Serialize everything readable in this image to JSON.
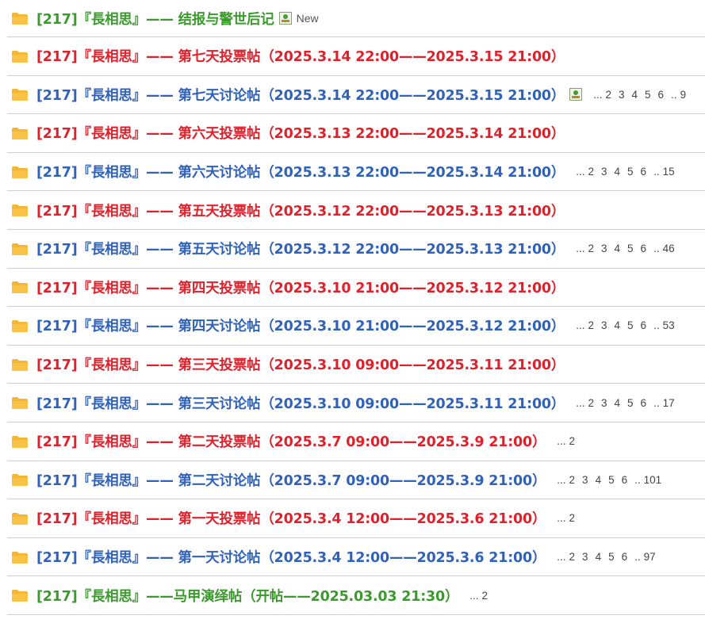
{
  "colors": {
    "green": "#3a9a2b",
    "red": "#e0202a",
    "blue": "#2f62b8",
    "folder": "#f5b732",
    "divider": "#cfcfcf"
  },
  "threads": [
    {
      "prefix": "[217]",
      "name": "『長相思』",
      "dash": "——",
      "topic": " 结报与警世后记",
      "date": "",
      "close": "",
      "color": "green",
      "has_image": true,
      "new_label": "New",
      "pager": []
    },
    {
      "prefix": "[217]",
      "name": "『長相思』",
      "dash": "——",
      "topic": " 第七天投票帖（",
      "date": "2025.3.14 22:00——2025.3.15 21:00",
      "close": "）",
      "color": "red",
      "has_image": false,
      "new_label": "",
      "pager": []
    },
    {
      "prefix": "[217]",
      "name": "『長相思』",
      "dash": "——",
      "topic": " 第七天讨论帖（",
      "date": "2025.3.14 22:00——2025.3.15 21:00",
      "close": "）",
      "color": "blue",
      "has_image": true,
      "new_label": "",
      "pager": [
        "2",
        "3",
        "4",
        "5",
        "6",
        "9"
      ]
    },
    {
      "prefix": "[217]",
      "name": "『長相思』",
      "dash": "——",
      "topic": " 第六天投票帖（",
      "date": "2025.3.13 22:00——2025.3.14 21:00",
      "close": "）",
      "color": "red",
      "has_image": false,
      "new_label": "",
      "pager": []
    },
    {
      "prefix": "[217]",
      "name": "『長相思』",
      "dash": "——",
      "topic": " 第六天讨论帖（",
      "date": "2025.3.13 22:00——2025.3.14 21:00",
      "close": "）",
      "color": "blue",
      "has_image": false,
      "new_label": "",
      "pager": [
        "2",
        "3",
        "4",
        "5",
        "6",
        "15"
      ]
    },
    {
      "prefix": "[217]",
      "name": "『長相思』",
      "dash": "——",
      "topic": " 第五天投票帖（",
      "date": "2025.3.12 22:00——2025.3.13 21:00",
      "close": "）",
      "color": "red",
      "has_image": false,
      "new_label": "",
      "pager": []
    },
    {
      "prefix": "[217]",
      "name": "『長相思』",
      "dash": "——",
      "topic": " 第五天讨论帖（",
      "date": "2025.3.12 22:00——2025.3.13 21:00",
      "close": "）",
      "color": "blue",
      "has_image": false,
      "new_label": "",
      "pager": [
        "2",
        "3",
        "4",
        "5",
        "6",
        "46"
      ]
    },
    {
      "prefix": "[217]",
      "name": "『長相思』",
      "dash": "——",
      "topic": " 第四天投票帖（",
      "date": "2025.3.10 21:00——2025.3.12 21:00",
      "close": "）",
      "color": "red",
      "has_image": false,
      "new_label": "",
      "pager": []
    },
    {
      "prefix": "[217]",
      "name": "『長相思』",
      "dash": "——",
      "topic": " 第四天讨论帖（",
      "date": "2025.3.10 21:00——2025.3.12 21:00",
      "close": "）",
      "color": "blue",
      "has_image": false,
      "new_label": "",
      "pager": [
        "2",
        "3",
        "4",
        "5",
        "6",
        "53"
      ]
    },
    {
      "prefix": "[217]",
      "name": "『長相思』",
      "dash": "——",
      "topic": " 第三天投票帖（",
      "date": "2025.3.10 09:00——2025.3.11 21:00",
      "close": "）",
      "color": "red",
      "has_image": false,
      "new_label": "",
      "pager": []
    },
    {
      "prefix": "[217]",
      "name": "『長相思』",
      "dash": "——",
      "topic": " 第三天讨论帖（",
      "date": "2025.3.10 09:00——2025.3.11 21:00",
      "close": "）",
      "color": "blue",
      "has_image": false,
      "new_label": "",
      "pager": [
        "2",
        "3",
        "4",
        "5",
        "6",
        "17"
      ]
    },
    {
      "prefix": "[217]",
      "name": "『長相思』",
      "dash": "——",
      "topic": " 第二天投票帖（",
      "date": "2025.3.7 09:00——2025.3.9 21:00",
      "close": "）",
      "color": "red",
      "has_image": false,
      "new_label": "",
      "pager": [
        "2"
      ]
    },
    {
      "prefix": "[217]",
      "name": "『長相思』",
      "dash": "——",
      "topic": " 第二天讨论帖（",
      "date": "2025.3.7 09:00——2025.3.9 21:00",
      "close": "）",
      "color": "blue",
      "has_image": false,
      "new_label": "",
      "pager": [
        "2",
        "3",
        "4",
        "5",
        "6",
        "101"
      ]
    },
    {
      "prefix": "[217]",
      "name": "『長相思』",
      "dash": "——",
      "topic": " 第一天投票帖（",
      "date": "2025.3.4 12:00——2025.3.6 21:00",
      "close": "）",
      "color": "red",
      "has_image": false,
      "new_label": "",
      "pager": [
        "2"
      ]
    },
    {
      "prefix": "[217]",
      "name": "『長相思』",
      "dash": "——",
      "topic": " 第一天讨论帖（",
      "date": "2025.3.4 12:00——2025.3.6 21:00",
      "close": "）",
      "color": "blue",
      "has_image": false,
      "new_label": "",
      "pager": [
        "2",
        "3",
        "4",
        "5",
        "6",
        "97"
      ]
    },
    {
      "prefix": "[217]",
      "name": "『長相思』",
      "dash": "——",
      "topic": "马甲演绎帖（开帖——",
      "date": "2025.03.03 21:30",
      "close": "）",
      "color": "green",
      "has_image": false,
      "new_label": "",
      "pager": [
        "2"
      ]
    }
  ],
  "pager_text": {
    "ellipsis": "...",
    "sep": ".."
  }
}
